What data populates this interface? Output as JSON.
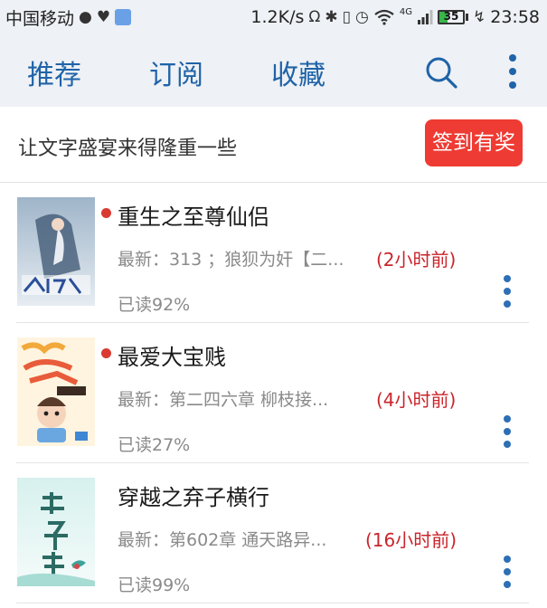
{
  "status_bar": {
    "carrier": "中国移动",
    "net_speed": "1.2K/s",
    "network_type": "4G",
    "battery": "35",
    "time": "23:58",
    "icons": [
      "leaf-icon",
      "heart-pulse-icon",
      "app-icon",
      "headphone-icon",
      "bluetooth-icon",
      "vibrate-icon",
      "alarm-icon",
      "wifi-icon",
      "signal-icon",
      "battery-icon",
      "charging-icon"
    ]
  },
  "nav": {
    "tabs": [
      "推荐",
      "订阅",
      "收藏"
    ],
    "accent": "#1f63a8",
    "icons": [
      "search-icon",
      "more-vertical-icon"
    ]
  },
  "banner": {
    "text": "让文字盛宴来得隆重一些",
    "button": "签到有奖",
    "button_color": "#ee3b33"
  },
  "books": [
    {
      "title": "重生之至尊仙侣",
      "latest": "最新：313 ；狼狈为奸【二...",
      "time": "(2小时前)",
      "progress": "已读92%",
      "unread_dot": true
    },
    {
      "title": "最爱大宝贱",
      "latest": "最新：第二四六章  柳枝接...",
      "time": "(4小时前)",
      "progress": "已读27%",
      "unread_dot": true
    },
    {
      "title": "穿越之弃子横行",
      "latest": "最新：第602章 通天路异...",
      "time": "(16小时前)",
      "progress": "已读99%",
      "unread_dot": false
    }
  ]
}
